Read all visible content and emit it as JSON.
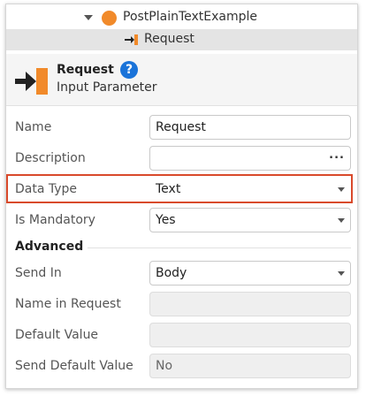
{
  "tree": {
    "parent": {
      "label": "PostPlainTextExample",
      "icon": "orange-circle-icon"
    },
    "selected": {
      "label": "Request",
      "icon": "input-parameter-icon"
    }
  },
  "header": {
    "title": "Request",
    "subtitle": "Input Parameter",
    "help_label": "?"
  },
  "properties": {
    "name": {
      "label": "Name",
      "value": "Request"
    },
    "description": {
      "label": "Description",
      "value": "",
      "button": "..."
    },
    "data_type": {
      "label": "Data Type",
      "value": "Text"
    },
    "is_mandatory": {
      "label": "Is Mandatory",
      "value": "Yes"
    },
    "advanced": {
      "label": "Advanced"
    },
    "send_in": {
      "label": "Send In",
      "value": "Body"
    },
    "name_in_request": {
      "label": "Name in Request",
      "value": ""
    },
    "default_value": {
      "label": "Default Value",
      "value": ""
    },
    "send_default_value": {
      "label": "Send Default Value",
      "value": "No"
    }
  },
  "colors": {
    "accent_orange": "#f18a2a",
    "highlight_red": "#d94a2b",
    "help_blue": "#1a73d9"
  }
}
